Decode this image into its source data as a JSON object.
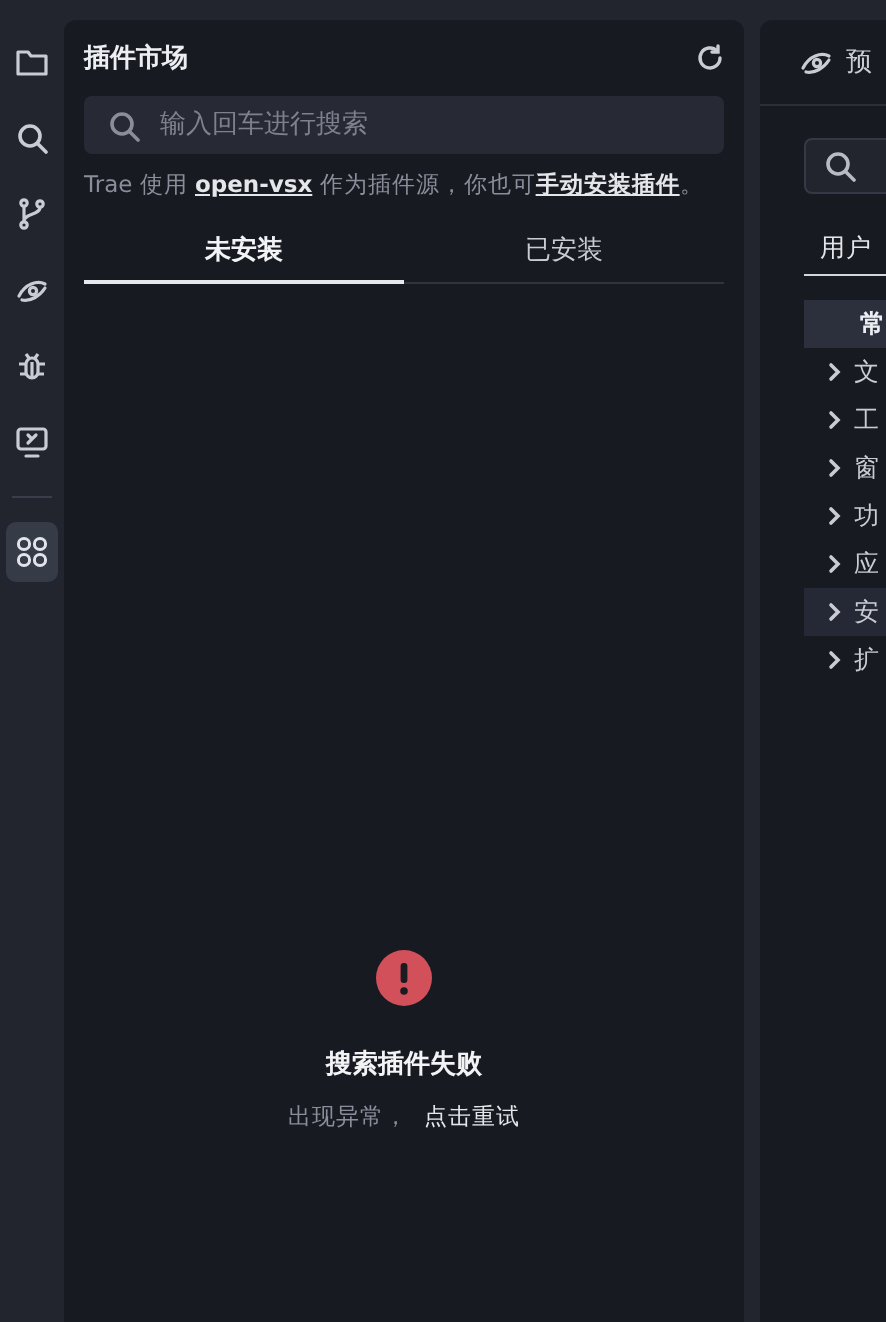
{
  "activity_bar": {
    "items": [
      {
        "kind": "folder",
        "selected": false
      },
      {
        "kind": "search",
        "selected": false
      },
      {
        "kind": "branch",
        "selected": false
      },
      {
        "kind": "eye",
        "selected": false
      },
      {
        "kind": "bug",
        "selected": false
      },
      {
        "kind": "monitor",
        "selected": false
      },
      {
        "kind": "grid",
        "selected": true
      }
    ]
  },
  "extensions_panel": {
    "title": "插件市场",
    "search": {
      "placeholder": "输入回车进行搜索"
    },
    "note": {
      "before": "Trae 使用 ",
      "link_1": "open-vsx",
      "middle": " 作为插件源，你也可",
      "link_2": "手动安装插件",
      "after": "。"
    },
    "tabs": [
      {
        "label": "未安装",
        "selected": true
      },
      {
        "label": "已安装",
        "selected": false
      }
    ],
    "error": {
      "title": "搜索插件失败",
      "message": "出现异常，",
      "retry": "点击重试"
    }
  },
  "preview_panel": {
    "title": "预",
    "tabs": [
      {
        "label": "用户",
        "selected": true
      }
    ],
    "items": [
      {
        "label": "常",
        "selected": true,
        "hovered": false,
        "expandable": false
      },
      {
        "label": "文",
        "selected": false,
        "hovered": false,
        "expandable": true
      },
      {
        "label": "工",
        "selected": false,
        "hovered": false,
        "expandable": true
      },
      {
        "label": "窗",
        "selected": false,
        "hovered": false,
        "expandable": true
      },
      {
        "label": "功",
        "selected": false,
        "hovered": false,
        "expandable": true
      },
      {
        "label": "应",
        "selected": false,
        "hovered": false,
        "expandable": true
      },
      {
        "label": "安",
        "selected": false,
        "hovered": true,
        "expandable": true
      },
      {
        "label": "扩",
        "selected": false,
        "hovered": false,
        "expandable": true
      }
    ]
  }
}
